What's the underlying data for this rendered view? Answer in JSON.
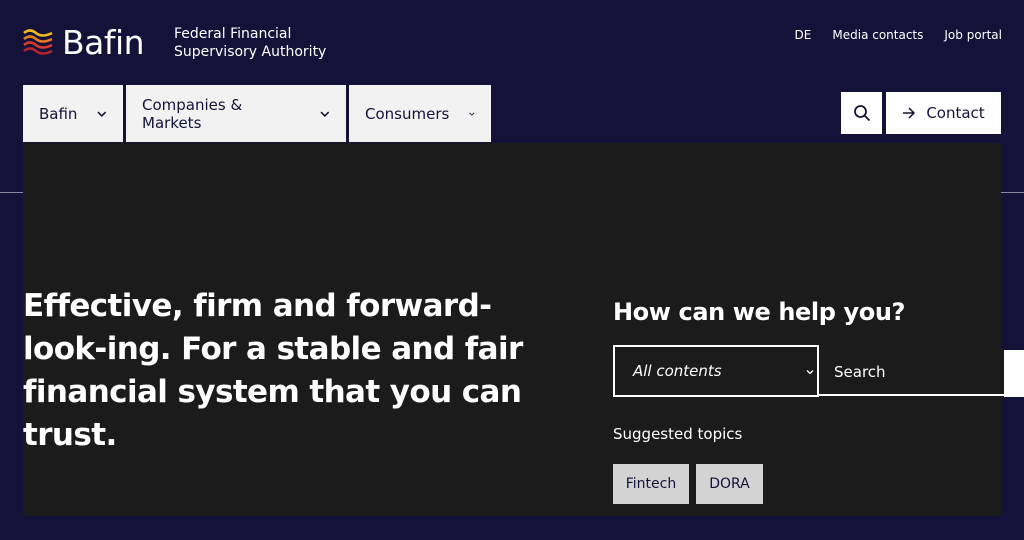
{
  "header": {
    "logo_text": "Bafin",
    "org_name": "Federal Financial Supervisory Authority",
    "utility_links": [
      "DE",
      "Media contacts",
      "Job portal"
    ]
  },
  "nav": {
    "items": [
      {
        "label": "Bafin"
      },
      {
        "label": "Companies & Markets"
      },
      {
        "label": "Consumers"
      }
    ],
    "contact_label": "Contact"
  },
  "hero": {
    "headline": "Effective, firm and forward-look-ing. For a stable and fair financial system that you can trust."
  },
  "help": {
    "title": "How can we help you?",
    "select_value": "All contents",
    "search_placeholder": "Search",
    "topics_label": "Suggested topics",
    "topics": [
      "Fintech",
      "DORA"
    ]
  },
  "colors": {
    "navy": "#15123a",
    "hero_bg": "#1b1b1b",
    "logo_red": "#d9372b",
    "logo_yellow": "#f2b81f"
  }
}
